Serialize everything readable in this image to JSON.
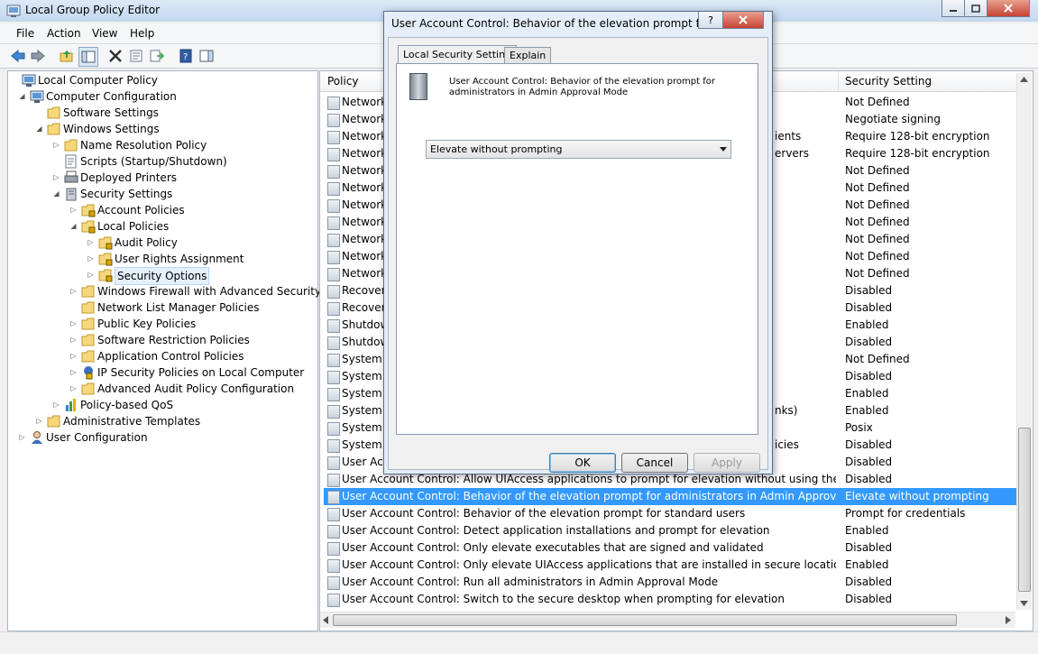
{
  "window": {
    "title": "Local Group Policy Editor"
  },
  "menu": [
    "File",
    "Action",
    "View",
    "Help"
  ],
  "tree": [
    {
      "label": "Local Computer Policy",
      "level": 0,
      "toggle": "",
      "icon": "computer-icon"
    },
    {
      "label": "Computer Configuration",
      "level": 1,
      "toggle": "◢",
      "icon": "computer-icon"
    },
    {
      "label": "Software Settings",
      "level": 2,
      "toggle": "",
      "icon": "folder-icon"
    },
    {
      "label": "Windows Settings",
      "level": 2,
      "toggle": "◢",
      "icon": "folder-icon"
    },
    {
      "label": "Name Resolution Policy",
      "level": 3,
      "toggle": "▷",
      "icon": "folder-icon"
    },
    {
      "label": "Scripts (Startup/Shutdown)",
      "level": 3,
      "toggle": "",
      "icon": "script-icon"
    },
    {
      "label": "Deployed Printers",
      "level": 3,
      "toggle": "▷",
      "icon": "printer-icon"
    },
    {
      "label": "Security Settings",
      "level": 3,
      "toggle": "◢",
      "icon": "security-icon"
    },
    {
      "label": "Account Policies",
      "level": 4,
      "toggle": "▷",
      "icon": "folder-lock-icon"
    },
    {
      "label": "Local Policies",
      "level": 4,
      "toggle": "◢",
      "icon": "folder-lock-icon"
    },
    {
      "label": "Audit Policy",
      "level": 5,
      "toggle": "▷",
      "icon": "folder-lock-icon"
    },
    {
      "label": "User Rights Assignment",
      "level": 5,
      "toggle": "▷",
      "icon": "folder-lock-icon"
    },
    {
      "label": "Security Options",
      "level": 5,
      "toggle": "▷",
      "icon": "folder-lock-icon",
      "selected": true
    },
    {
      "label": "Windows Firewall with Advanced Security",
      "level": 4,
      "toggle": "▷",
      "icon": "folder-icon"
    },
    {
      "label": "Network List Manager Policies",
      "level": 4,
      "toggle": "",
      "icon": "folder-icon"
    },
    {
      "label": "Public Key Policies",
      "level": 4,
      "toggle": "▷",
      "icon": "folder-icon"
    },
    {
      "label": "Software Restriction Policies",
      "level": 4,
      "toggle": "▷",
      "icon": "folder-icon"
    },
    {
      "label": "Application Control Policies",
      "level": 4,
      "toggle": "▷",
      "icon": "folder-icon"
    },
    {
      "label": "IP Security Policies on Local Computer",
      "level": 4,
      "toggle": "▷",
      "icon": "ipsec-icon"
    },
    {
      "label": "Advanced Audit Policy Configuration",
      "level": 4,
      "toggle": "▷",
      "icon": "folder-icon"
    },
    {
      "label": "Policy-based QoS",
      "level": 3,
      "toggle": "▷",
      "icon": "chart-icon"
    },
    {
      "label": "Administrative Templates",
      "level": 2,
      "toggle": "▷",
      "icon": "folder-icon"
    },
    {
      "label": "User Configuration",
      "level": 1,
      "toggle": "▷",
      "icon": "user-icon"
    }
  ],
  "list": {
    "col_policy": "Policy",
    "col_setting": "Security Setting",
    "rows": [
      {
        "policy": "Network",
        "setting": "Not Defined"
      },
      {
        "policy": "Network",
        "setting": "Negotiate signing"
      },
      {
        "policy": "Network",
        "suffix": "ients",
        "setting": "Require 128-bit encryption"
      },
      {
        "policy": "Network",
        "suffix": "ervers",
        "setting": "Require 128-bit encryption"
      },
      {
        "policy": "Network",
        "setting": "Not Defined"
      },
      {
        "policy": "Network",
        "setting": "Not Defined"
      },
      {
        "policy": "Network",
        "setting": "Not Defined"
      },
      {
        "policy": "Network",
        "setting": "Not Defined"
      },
      {
        "policy": "Network",
        "setting": "Not Defined"
      },
      {
        "policy": "Network",
        "setting": "Not Defined"
      },
      {
        "policy": "Network",
        "setting": "Not Defined"
      },
      {
        "policy": "Recovery",
        "setting": "Disabled"
      },
      {
        "policy": "Recovery",
        "setting": "Disabled"
      },
      {
        "policy": "Shutdow",
        "setting": "Enabled"
      },
      {
        "policy": "Shutdow",
        "setting": "Disabled"
      },
      {
        "policy": "System c",
        "setting": "Not Defined"
      },
      {
        "policy": "System c",
        "setting": "Disabled"
      },
      {
        "policy": "System o",
        "setting": "Enabled"
      },
      {
        "policy": "System o",
        "suffix": "nks)",
        "setting": "Enabled"
      },
      {
        "policy": "System s",
        "setting": "Posix"
      },
      {
        "policy": "System s",
        "suffix": "icies",
        "setting": "Disabled"
      },
      {
        "policy": "User Acc",
        "setting": "Disabled"
      },
      {
        "policy": "User Account Control: Allow UIAccess applications to prompt for elevation without using the secure d...",
        "setting": "Disabled"
      },
      {
        "policy": "User Account Control: Behavior of the elevation prompt for administrators in Admin Approval Mode",
        "setting": "Elevate without prompting",
        "selected": true
      },
      {
        "policy": "User Account Control: Behavior of the elevation prompt for standard users",
        "setting": "Prompt for credentials"
      },
      {
        "policy": "User Account Control: Detect application installations and prompt for elevation",
        "setting": "Enabled"
      },
      {
        "policy": "User Account Control: Only elevate executables that are signed and validated",
        "setting": "Disabled"
      },
      {
        "policy": "User Account Control: Only elevate UIAccess applications that are installed in secure locations",
        "setting": "Enabled"
      },
      {
        "policy": "User Account Control: Run all administrators in Admin Approval Mode",
        "setting": "Disabled"
      },
      {
        "policy": "User Account Control: Switch to the secure desktop when prompting for elevation",
        "setting": "Disabled"
      }
    ]
  },
  "dialog": {
    "title": "User Account Control: Behavior of the elevation prompt for a...",
    "help_label": "?",
    "tab_active": "Local Security Setting",
    "tab_inactive": "Explain",
    "policy_title": "User Account Control: Behavior of the elevation prompt for administrators in Admin Approval Mode",
    "selected_value": "Elevate without prompting",
    "ok": "OK",
    "cancel": "Cancel",
    "apply": "Apply"
  },
  "colors": {
    "selection": "#3399ff",
    "accent": "#2b67a6"
  }
}
